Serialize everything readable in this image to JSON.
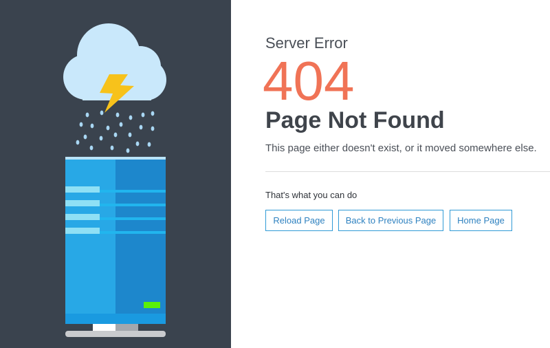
{
  "error": {
    "subtitle": "Server Error",
    "code": "404",
    "title": "Page Not Found",
    "description": "This page either doesn't exist, or it moved somewhere else."
  },
  "actions": {
    "label": "That's what you can do",
    "buttons": {
      "reload": "Reload Page",
      "back": "Back to Previous Page",
      "home": "Home Page"
    }
  },
  "colors": {
    "panel_background": "#3a434e",
    "error_code": "#f07356",
    "button_border": "#2f9ad6",
    "server_body": "#1f9de0",
    "cloud": "#c9e8fb",
    "lightning": "#f7c21b",
    "status_led": "#5af00a"
  },
  "illustration": {
    "icons": [
      "cloud-icon",
      "lightning-icon",
      "rain-drops",
      "server-icon",
      "status-led"
    ]
  }
}
